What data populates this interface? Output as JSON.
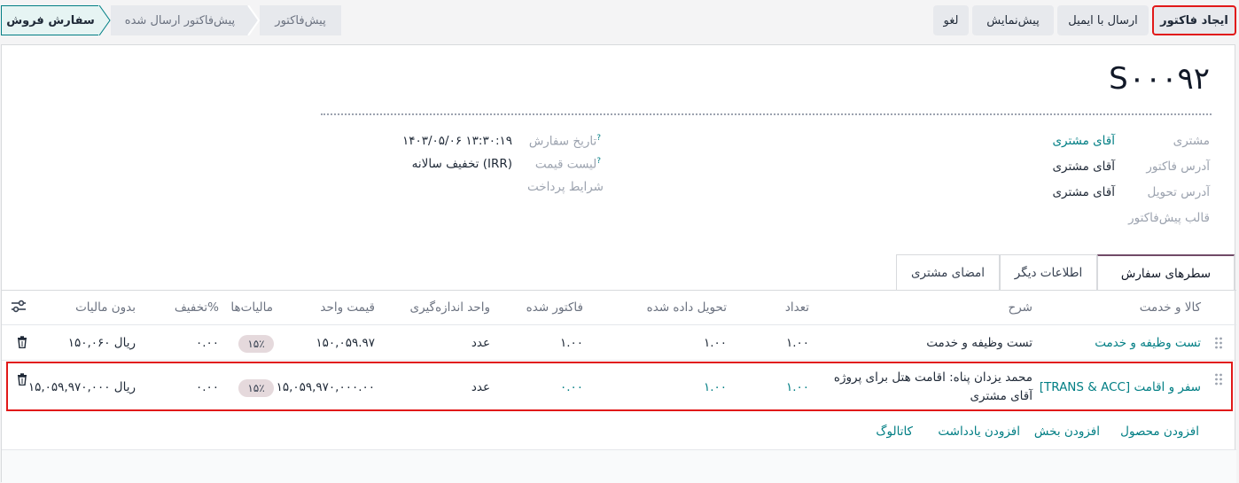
{
  "actions": {
    "create_invoice": "ایجاد فاکتور",
    "send_email": "ارسال با ایمیل",
    "preview": "پیش‌نمایش",
    "cancel": "لغو"
  },
  "stages": [
    {
      "label": "سفارش فروش",
      "active": true
    },
    {
      "label": "پیش‌فاکتور ارسال شده",
      "active": false
    },
    {
      "label": "پیش‌فاکتور",
      "active": false
    }
  ],
  "order": {
    "name": "S۰۰۰۹۲",
    "customer_label": "مشتری",
    "customer_value": "آقای مشتری",
    "invoice_address_label": "آدرس فاکتور",
    "invoice_address_value": "آقای مشتری",
    "delivery_address_label": "آدرس تحویل",
    "delivery_address_value": "آقای مشتری",
    "quote_template_label": "قالب پیش‌فاکتور",
    "order_date_label": "تاریخ سفارش",
    "order_date_value": "۱۴۰۳/۰۵/۰۶ ۱۳:۳۰:۱۹",
    "pricelist_label": "لیست قیمت",
    "pricelist_value": "تخفیف سالانه (IRR)",
    "payment_terms_label": "شرایط پرداخت",
    "help_mark": "?"
  },
  "tabs": [
    {
      "label": "سطرهای سفارش",
      "active": true
    },
    {
      "label": "اطلاعات دیگر",
      "active": false
    },
    {
      "label": "امضای مشتری",
      "active": false
    }
  ],
  "table": {
    "headers": {
      "product": "کالا و خدمت",
      "description": "شرح",
      "quantity": "تعداد",
      "delivered": "تحویل داده شده",
      "invoiced": "فاکتور شده",
      "uom": "واحد اندازه‌گیری",
      "unit_price": "قیمت واحد",
      "taxes": "مالیات‌ها",
      "discount": "تخفیف%",
      "subtotal": "بدون مالیات"
    },
    "rows": [
      {
        "product": "تست وظیفه و خدمت",
        "description": "تست وظیفه و خدمت",
        "description2": "",
        "quantity": "۱.۰۰",
        "delivered": "۱.۰۰",
        "invoiced": "۱.۰۰",
        "uom": "عدد",
        "unit_price": "۱۵۰,۰۵۹.۹۷",
        "tax": "۱۵٪",
        "discount": "۰.۰۰",
        "subtotal": "۱۵۰,۰۶۰ ریال"
      },
      {
        "product": "[TRANS & ACC] سفر و اقامت",
        "description": "محمد یزدان پناه: اقامت هتل برای پروژه",
        "description2": "آقای مشتری",
        "quantity": "۱.۰۰",
        "delivered": "۱.۰۰",
        "invoiced": "۰.۰۰",
        "uom": "عدد",
        "unit_price": "۱۵,۰۵۹,۹۷۰,۰۰۰.۰۰",
        "tax": "۱۵٪",
        "discount": "۰.۰۰",
        "subtotal": "۱۵,۰۵۹,۹۷۰,۰۰۰ ریال"
      }
    ]
  },
  "add_links": {
    "add_product": "افزودن محصول",
    "add_section": "افزودن بخش",
    "add_note": "افزودن یادداشت",
    "catalog": "کاتالوگ"
  },
  "colors": {
    "accent": "#017e84",
    "highlight": "#e11919",
    "tab_active": "#714b67"
  }
}
